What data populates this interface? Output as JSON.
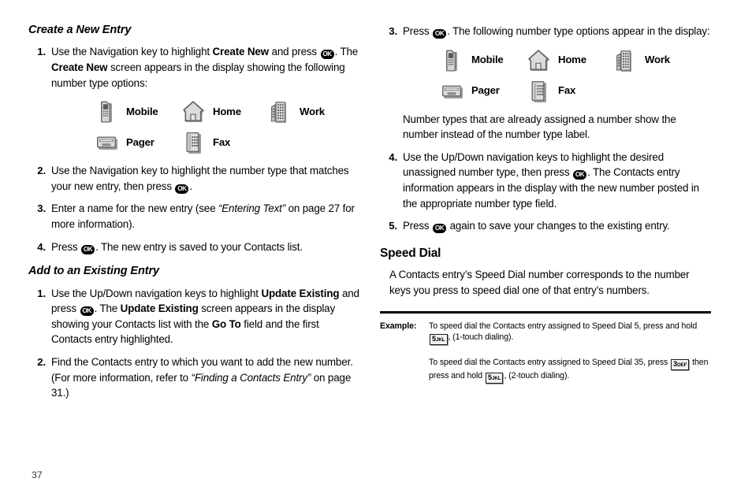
{
  "page_number": "37",
  "left_column": {
    "section1": {
      "heading": "Create a New Entry",
      "step1_a": "Use the Navigation key to highlight ",
      "step1_b": "Create New",
      "step1_c": " and press ",
      "step1_d": ". The ",
      "step1_e": "Create New",
      "step1_f": " screen appears in the display showing the following number type options:",
      "step2_a": "Use the Navigation key to highlight the number type that matches your new entry, then press ",
      "step2_b": ".",
      "step3_a": "Enter a name for the new entry (see ",
      "step3_b": "“Entering Text”",
      "step3_c": " on page 27 for more information).",
      "step4_a": "Press ",
      "step4_b": ". The new entry is saved to your Contacts list.",
      "numbers": [
        "1.",
        "2.",
        "3.",
        "4."
      ]
    },
    "section2": {
      "heading": "Add to an Existing Entry",
      "step1_a": "Use the Up/Down navigation keys to highlight ",
      "step1_b": "Update Existing",
      "step1_c": " and press ",
      "step1_d": ". The ",
      "step1_e": "Update Existing",
      "step1_f": " screen appears in the display showing your Contacts list with the ",
      "step1_g": "Go To",
      "step1_h": " field and the first Contacts entry highlighted.",
      "step2_a": "Find the Contacts entry to which you want to add the new number. (For more information, refer to ",
      "step2_b": "“Finding a Contacts Entry”",
      "step2_c": " on page 31.)",
      "numbers": [
        "1.",
        "2."
      ]
    }
  },
  "right_column": {
    "step3_a": "Press ",
    "step3_b": ". The following number type options appear in the display:",
    "note": "Number types that are already assigned a number show the number instead of the number type label.",
    "step4_a": "Use the Up/Down navigation keys to highlight the desired unassigned number type, then press ",
    "step4_b": ". The Contacts entry information appears in the display with the new number posted in the appropriate number type field.",
    "step5_a": "Press ",
    "step5_b": " again to save your changes to the existing entry.",
    "numbers": [
      "3.",
      "4.",
      "5."
    ],
    "speed_dial": {
      "heading": "Speed Dial",
      "body": "A Contacts entry’s Speed Dial number corresponds to the number keys you press to speed dial one of that entry’s numbers."
    },
    "example": {
      "label": "Example:",
      "line1_a": "To speed dial the Contacts entry assigned to Speed Dial 5, press and hold ",
      "line1_b": ", (1-touch dialing).",
      "line2_a": "To speed dial the Contacts entry assigned to Speed Dial 35, press ",
      "line2_b": " then press and hold ",
      "line2_c": ", (2-touch dialing)."
    }
  },
  "number_types": {
    "row1": [
      {
        "icon": "mobile-phone-icon",
        "label": "Mobile"
      },
      {
        "icon": "house-icon",
        "label": "Home"
      },
      {
        "icon": "office-building-icon",
        "label": "Work"
      }
    ],
    "row2": [
      {
        "icon": "pager-icon",
        "label": "Pager"
      },
      {
        "icon": "fax-machine-icon",
        "label": "Fax"
      }
    ]
  },
  "keys": {
    "ok": "OK",
    "key5_digit": "5",
    "key5_letters": "JKL",
    "key3_digit": "3",
    "key3_letters": "DEF"
  },
  "colors": {
    "text": "#000000",
    "icon_dark": "#4d4d4d",
    "icon_light": "#d9d9d9",
    "rule": "#000000"
  }
}
